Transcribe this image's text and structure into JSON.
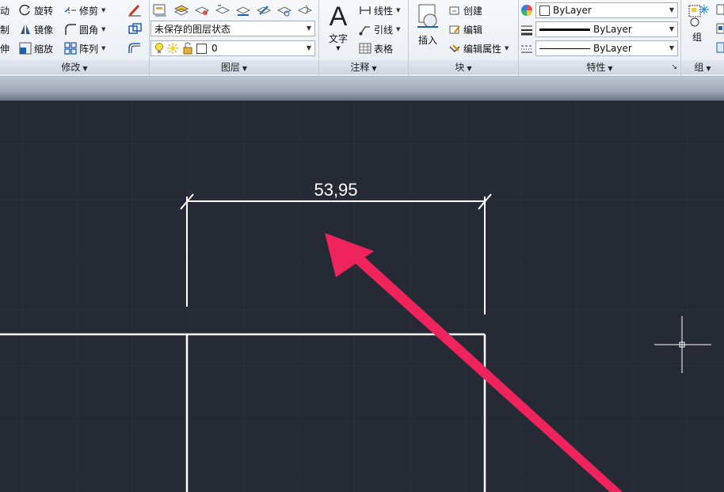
{
  "ribbon": {
    "modify": {
      "title": "修改",
      "row1": {
        "left": "动",
        "rotate": "旋转",
        "trim": "修剪"
      },
      "row2": {
        "left": "制",
        "mirror": "镜像",
        "fillet": "圆角"
      },
      "row3": {
        "left": "伸",
        "scale": "缩放",
        "array": "阵列"
      }
    },
    "layers": {
      "title": "图层",
      "state_combo": "未保存的图层状态",
      "layer_combo": "0"
    },
    "annotation": {
      "title": "注释",
      "text": "文字",
      "linear": "线性",
      "leader": "引线",
      "table": "表格"
    },
    "block": {
      "title": "块",
      "insert": "插入",
      "create": "创建",
      "edit": "编辑",
      "edit_attr": "编辑属性"
    },
    "properties": {
      "title": "特性",
      "color": "ByLayer",
      "lineweight": "ByLayer",
      "linetype": "ByLayer"
    },
    "group": {
      "title": "组",
      "label": "组"
    }
  },
  "drawing": {
    "dimension_text": "53,95",
    "arrow_color": "#f0245c",
    "line_color": "#ffffff",
    "background": "#252a34"
  }
}
